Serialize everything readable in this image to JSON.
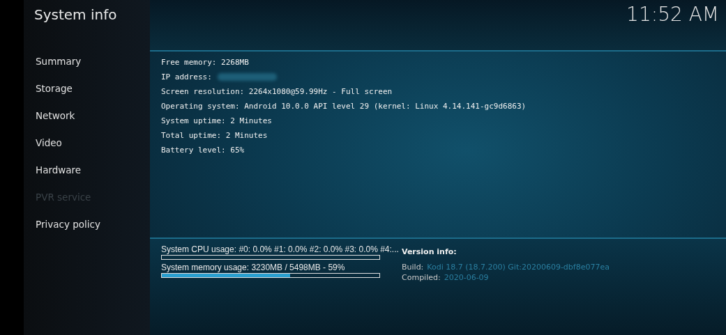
{
  "window": {
    "title": "System info",
    "clock": "11:52 AM"
  },
  "sidebar": {
    "items": [
      {
        "label": "Summary",
        "disabled": false
      },
      {
        "label": "Storage",
        "disabled": false
      },
      {
        "label": "Network",
        "disabled": false
      },
      {
        "label": "Video",
        "disabled": false
      },
      {
        "label": "Hardware",
        "disabled": false
      },
      {
        "label": "PVR service",
        "disabled": true
      },
      {
        "label": "Privacy policy",
        "disabled": false
      }
    ]
  },
  "info_lines": [
    {
      "text": "Free memory: 2268MB",
      "redacted": false
    },
    {
      "text": "IP address:",
      "redacted": true
    },
    {
      "text": "Screen resolution: 2264x1080@59.99Hz - Full screen",
      "redacted": false
    },
    {
      "text": "Operating system: Android 10.0.0 API level 29 (kernel: Linux 4.14.141-gc9d6863)",
      "redacted": false
    },
    {
      "text": "System uptime: 2 Minutes",
      "redacted": false
    },
    {
      "text": "Total uptime: 2 Minutes",
      "redacted": false
    },
    {
      "text": "Battery level: 65%",
      "redacted": false
    }
  ],
  "usage": [
    {
      "label": "System CPU usage: #0: 0.0% #1: 0.0% #2: 0.0% #3: 0.0% #4:...",
      "level": 0
    },
    {
      "label": "System memory usage: 3230MB / 5498MB - 59%",
      "level": 0.59
    }
  ],
  "version_info": {
    "title": "Version info:",
    "rows": [
      {
        "label": "Build:",
        "value": "Kodi 18.7 (18.7.200) Git:20200609-dbf8e077ea"
      },
      {
        "label": "Compiled:",
        "value": "2020-06-09"
      }
    ]
  }
}
